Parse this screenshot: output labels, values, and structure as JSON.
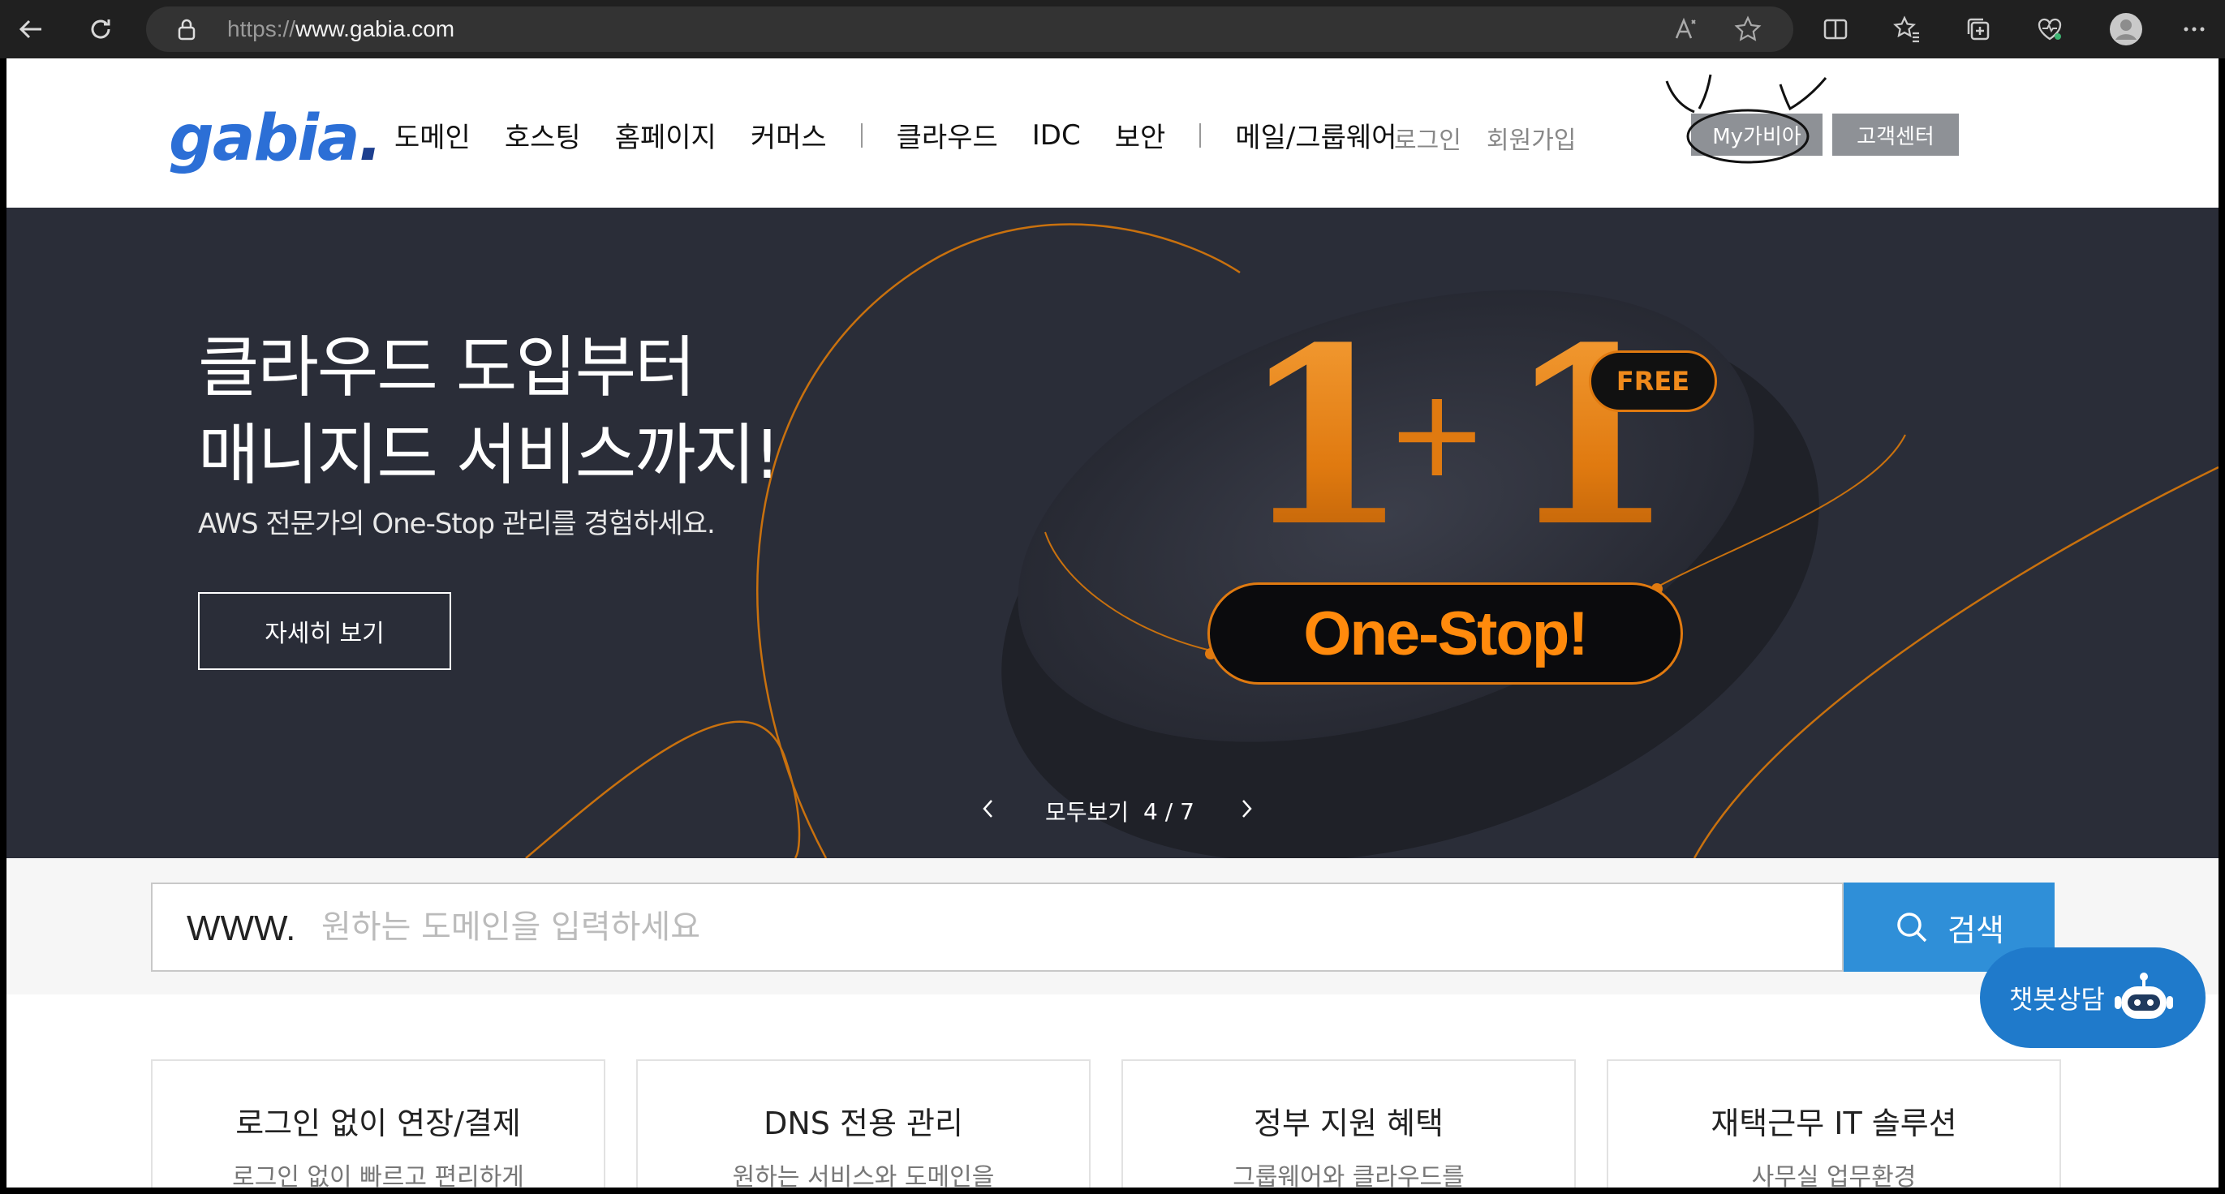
{
  "browser": {
    "url_prefix": "https://",
    "url_host": "www.gabia.com"
  },
  "header": {
    "logo": "gabia",
    "logo_dot": ".",
    "nav": [
      "도메인",
      "호스팅",
      "홈페이지",
      "커머스",
      "클라우드",
      "IDC",
      "보안",
      "메일/그룹웨어"
    ],
    "login": "로그인",
    "join": "회원가입",
    "my_gabia": "My가비아",
    "customer_center": "고객센터"
  },
  "hero": {
    "title_line1": "클라우드 도입부터",
    "title_line2": "매니지드 서비스까지!",
    "subtitle": "AWS 전문가의 One-Stop 관리를 경험하세요.",
    "button": "자세히 보기",
    "promo_number_left": "1",
    "promo_plus": "+",
    "promo_number_right": "1",
    "free_badge": "FREE",
    "onestop_badge": "One-Stop!",
    "pager_label": "모두보기",
    "pager_count": "4 / 7"
  },
  "search": {
    "prefix": "WWW.",
    "placeholder": "원하는 도메인을 입력하세요",
    "button": "검색"
  },
  "chatbot": {
    "label": "챗봇상담"
  },
  "cards": [
    {
      "title": "로그인 없이 연장/결제",
      "sub": "로그인 없이 빠르고 편리하게"
    },
    {
      "title": "DNS 전용 관리",
      "sub": "원하는 서비스와 도메인을"
    },
    {
      "title": "정부 지원 혜택",
      "sub": "그룹웨어와 클라우드를"
    },
    {
      "title": "재택근무 IT 솔루션",
      "sub": "사무실 업무환경"
    }
  ],
  "colors": {
    "accent_orange": "#e07a10",
    "hero_bg": "#2a2d38",
    "search_blue": "#2f8fd8",
    "chatbot_blue": "#1f7acb",
    "logo_blue": "#2c6fd6"
  }
}
